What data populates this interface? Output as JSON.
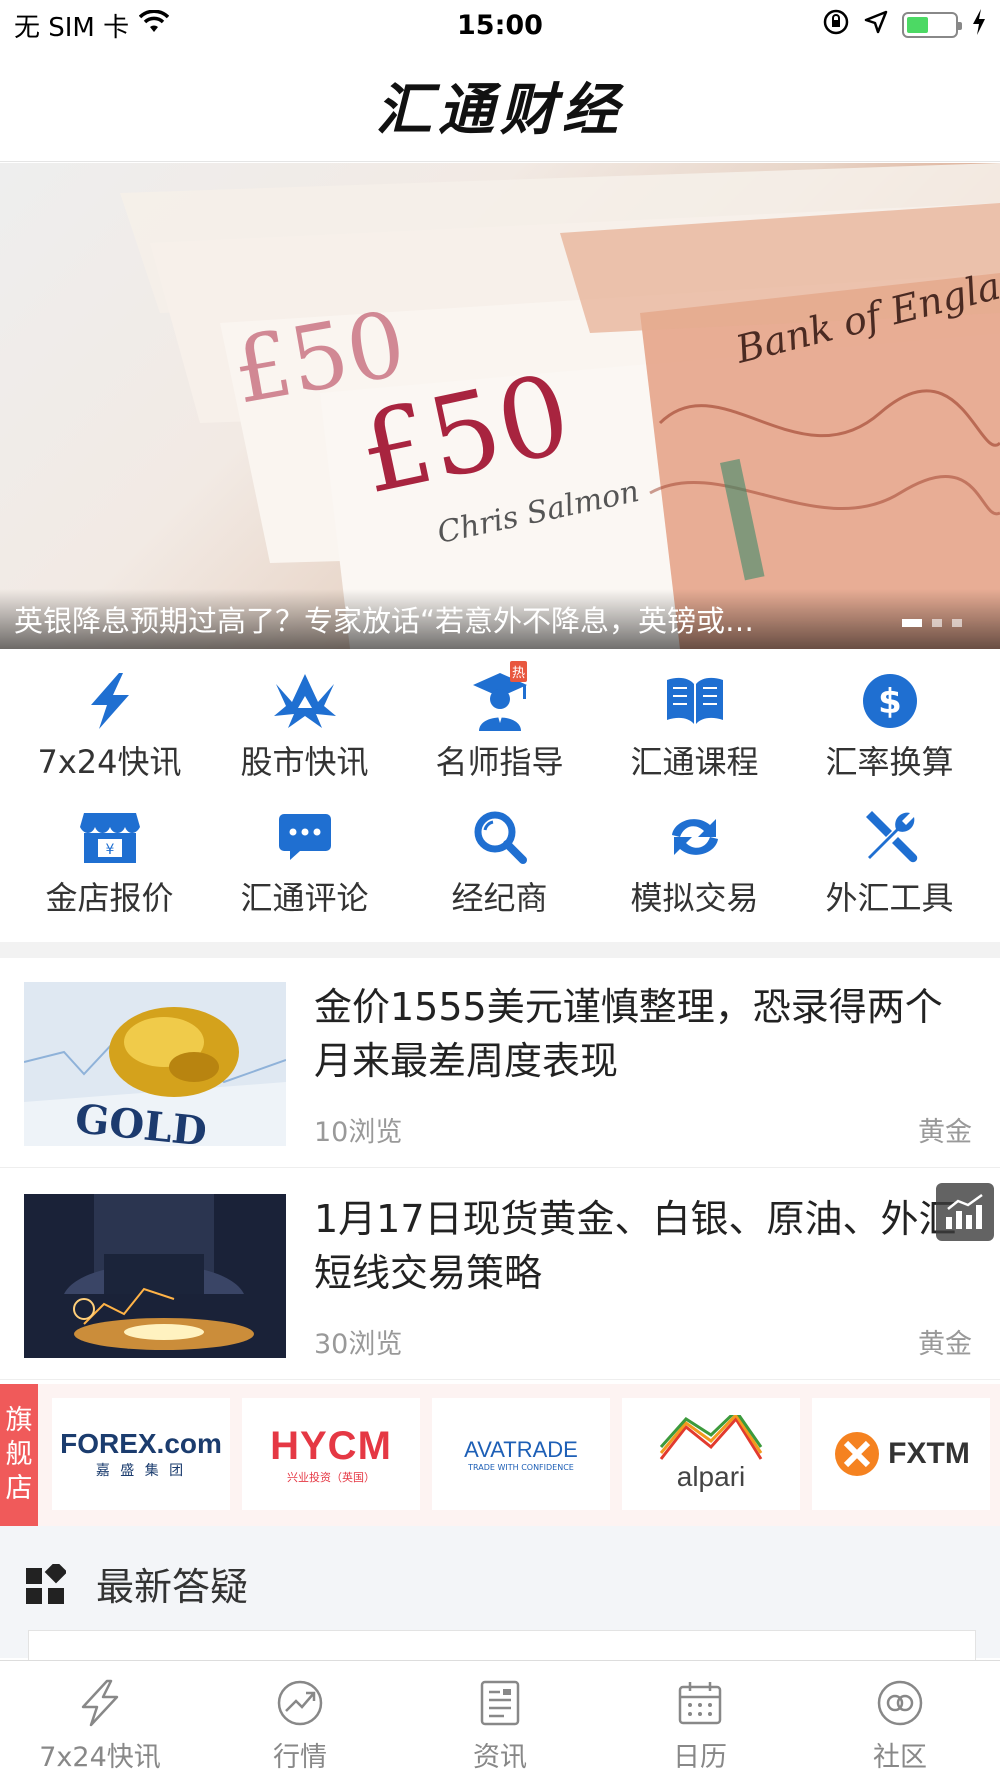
{
  "status_bar": {
    "carrier": "无 SIM 卡",
    "time": "15:00",
    "battery_level": 0.45,
    "battery_color": "#4cd964"
  },
  "header": {
    "title": "汇通财经"
  },
  "banner": {
    "caption": "英银降息预期过高了？专家放话“若意外不降息，英镑或…",
    "slide_count": 3,
    "active_slide": 1,
    "note_text": "£50"
  },
  "quick_menu": [
    {
      "label": "7x24快讯",
      "icon": "lightning-icon"
    },
    {
      "label": "股市快讯",
      "icon": "bull-icon"
    },
    {
      "label": "名师指导",
      "icon": "teacher-icon",
      "badge": "热"
    },
    {
      "label": "汇通课程",
      "icon": "book-icon"
    },
    {
      "label": "汇率换算",
      "icon": "dollar-icon"
    },
    {
      "label": "金店报价",
      "icon": "gold-shop-icon"
    },
    {
      "label": "汇通评论",
      "icon": "comment-icon"
    },
    {
      "label": "经纪商",
      "icon": "search-icon"
    },
    {
      "label": "模拟交易",
      "icon": "refresh-icon"
    },
    {
      "label": "外汇工具",
      "icon": "tools-icon"
    }
  ],
  "news": [
    {
      "title": "金价1555美元谨慎整理，恐录得两个月来最差周度表现",
      "views": "10浏览",
      "tag": "黄金",
      "thumb_text": "GOLD"
    },
    {
      "title": "1月17日现货黄金、白银、原油、外汇短线交易策略",
      "views": "30浏览",
      "tag": "黄金"
    }
  ],
  "flagship": {
    "tag": [
      "旗",
      "舰",
      "店"
    ],
    "brands": [
      {
        "name": "FOREX.com",
        "sub": "嘉 盛 集 团"
      },
      {
        "name": "HYCM",
        "sub": "兴业投资（英国）"
      },
      {
        "name": "AVATRADE",
        "sub": "TRADE WITH CONFIDENCE"
      },
      {
        "name": "alpari"
      },
      {
        "name": "FXTM"
      }
    ]
  },
  "qa": {
    "title": "最新答疑"
  },
  "tabs": [
    {
      "label": "7x24快讯",
      "icon": "lightning-outline-icon"
    },
    {
      "label": "行情",
      "icon": "trend-icon"
    },
    {
      "label": "资讯",
      "icon": "news-icon"
    },
    {
      "label": "日历",
      "icon": "calendar-icon"
    },
    {
      "label": "社区",
      "icon": "community-icon"
    }
  ],
  "colors": {
    "accent": "#1f6fd1",
    "flagship_red": "#f05a5a",
    "hot_badge": "#e8573f"
  }
}
